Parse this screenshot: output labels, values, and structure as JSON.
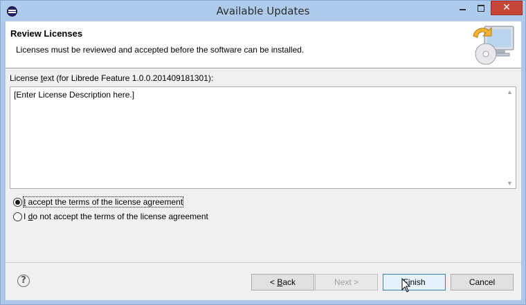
{
  "window": {
    "title": "Available Updates",
    "minimize_glyph": "",
    "maximize_glyph": "",
    "close_glyph": "✕"
  },
  "header": {
    "title": "Review Licenses",
    "description": "Licenses must be reviewed and accepted before the software can be installed.",
    "graphic_icon": "install-update-icon"
  },
  "license": {
    "label_pre": "License ",
    "label_mnemonic": "t",
    "label_post": "ext (for Librede Feature 1.0.0.201409181301):",
    "text": "[Enter License Description here.]"
  },
  "options": {
    "accept_mnemonic": "I",
    "accept_rest": " accept the terms of the license agreement",
    "accept_selected": true,
    "decline_pre": "I ",
    "decline_mnemonic": "d",
    "decline_rest": "o not accept the terms of the license agreement",
    "decline_selected": false
  },
  "buttons": {
    "help_glyph": "?",
    "back_pre": "< ",
    "back_mnemonic": "B",
    "back_rest": "ack",
    "next": "Next >",
    "finish_mnemonic": "F",
    "finish_rest": "inish",
    "cancel": "Cancel"
  },
  "colors": {
    "titlebar": "#aecbeb",
    "close_button": "#c7463a",
    "default_button_border": "#3c7fb1"
  }
}
